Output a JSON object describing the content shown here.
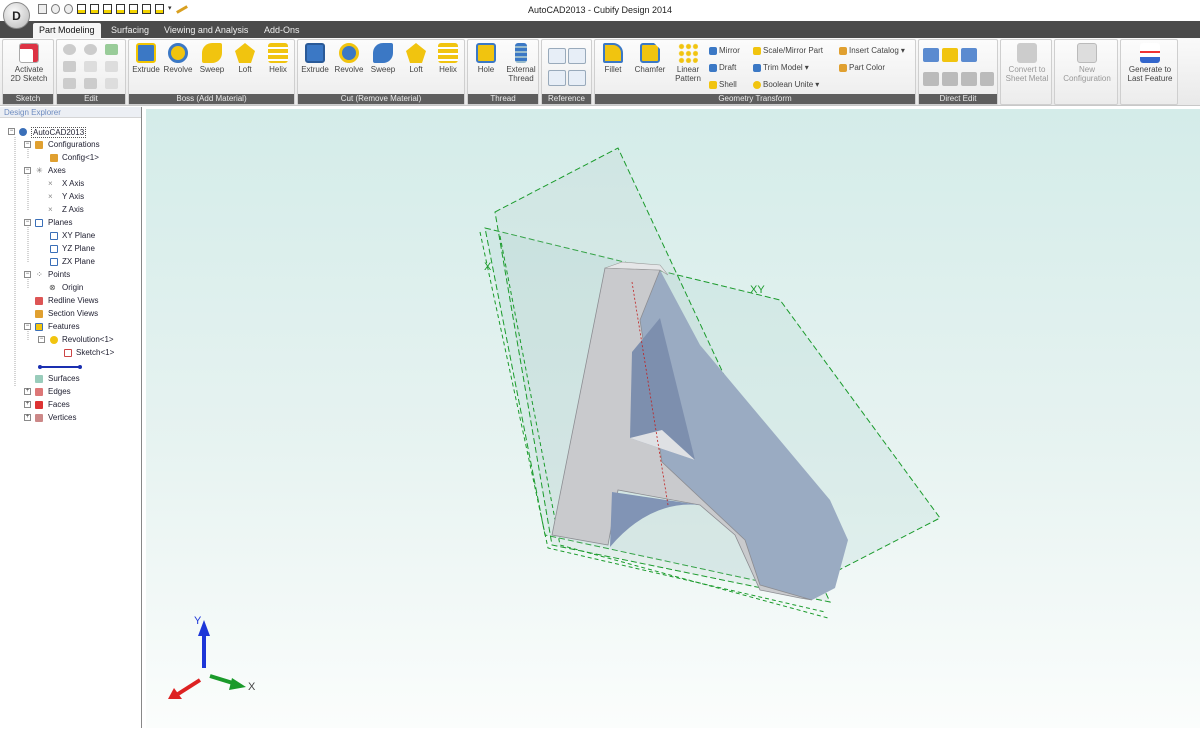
{
  "app": {
    "logo_letter": "D",
    "title": "AutoCAD2013 - Cubify Design 2014"
  },
  "tabs": [
    "Part Modeling",
    "Surfacing",
    "Viewing and Analysis",
    "Add-Ons"
  ],
  "groups": {
    "sketch": "Sketch",
    "edit": "Edit",
    "boss": "Boss (Add Material)",
    "cut": "Cut (Remove Material)",
    "thread": "Thread",
    "reference": "Reference",
    "geometry": "Geometry Transform",
    "direct": "Direct Edit"
  },
  "buttons": {
    "activate_1": "Activate",
    "activate_2": "2D Sketch",
    "extrude": "Extrude",
    "revolve": "Revolve",
    "sweep": "Sweep",
    "loft": "Loft",
    "helix": "Helix",
    "cut_extrude": "Extrude",
    "cut_revolve": "Revolve",
    "cut_sweep": "Sweep",
    "cut_loft": "Loft",
    "cut_helix": "Helix",
    "hole": "Hole",
    "ext_thread_1": "External",
    "ext_thread_2": "Thread",
    "fillet": "Fillet",
    "chamfer": "Chamfer",
    "linear_1": "Linear",
    "linear_2": "Pattern",
    "mirror": "Mirror",
    "draft": "Draft",
    "shell": "Shell",
    "scale_mirror": "Scale/Mirror Part",
    "trim_model": "Trim Model",
    "boolean_unite": "Boolean Unite",
    "insert_catalog": "Insert Catalog",
    "part_color": "Part Color",
    "convert_1": "Convert to",
    "convert_2": "Sheet Metal",
    "newconf_1": "New",
    "newconf_2": "Configuration",
    "generate_1": "Generate to",
    "generate_2": "Last Feature"
  },
  "explorer": {
    "title": "Design Explorer",
    "root": "AutoCAD2013",
    "configurations": "Configurations",
    "config1": "Config<1>",
    "axes": "Axes",
    "x_axis": "X Axis",
    "y_axis": "Y Axis",
    "z_axis": "Z Axis",
    "planes": "Planes",
    "xy_plane": "XY Plane",
    "yz_plane": "YZ Plane",
    "zx_plane": "ZX Plane",
    "points": "Points",
    "origin": "Origin",
    "redline": "Redline Views",
    "section": "Section Views",
    "features": "Features",
    "revolution": "Revolution<1>",
    "sketch": "Sketch<1>",
    "surfaces": "Surfaces",
    "edges": "Edges",
    "faces": "Faces",
    "vertices": "Vertices"
  },
  "viewport": {
    "triad_x": "X",
    "triad_y": "Y",
    "plane_xy": "XY",
    "plane_x": "X"
  }
}
